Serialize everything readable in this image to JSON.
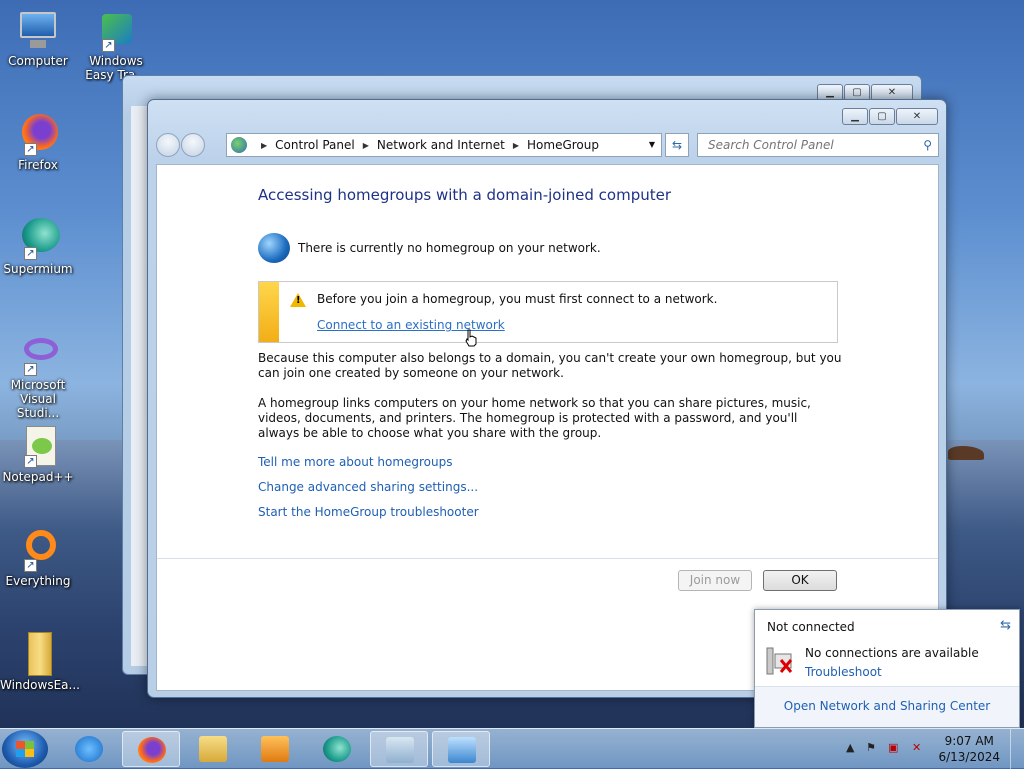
{
  "desktop": {
    "icons": [
      {
        "label": "Computer",
        "icon": "computer-icon"
      },
      {
        "label": "Windows Easy Tra...",
        "icon": "easy-transfer-icon"
      },
      {
        "label": "Firefox",
        "icon": "firefox-icon"
      },
      {
        "label": "Supermium",
        "icon": "supermium-icon"
      },
      {
        "label": "Microsoft Visual Studi...",
        "icon": "visual-studio-icon"
      },
      {
        "label": "Notepad++",
        "icon": "notepadpp-icon"
      },
      {
        "label": "Everything",
        "icon": "everything-icon"
      },
      {
        "label": "WindowsEa...",
        "icon": "folder-icon"
      }
    ]
  },
  "window": {
    "breadcrumb": [
      "Control Panel",
      "Network and Internet",
      "HomeGroup"
    ],
    "search_placeholder": "Search Control Panel",
    "heading": "Accessing homegroups with a domain-joined computer",
    "status": "There is currently no homegroup on your network.",
    "warning": {
      "text": "Before you join a homegroup, you must first connect to a network.",
      "link": "Connect to an existing network"
    },
    "para1": "Because this computer also belongs to a domain, you can't create your own homegroup, but you can join one created by someone on your network.",
    "para2": "A homegroup links computers on your home network so that you can share pictures, music, videos, documents, and printers. The homegroup is protected with a password, and you'll always be able to choose what you share with the group.",
    "links": [
      "Tell me more about homegroups",
      "Change advanced sharing settings...",
      "Start the HomeGroup troubleshooter"
    ],
    "buttons": {
      "join": "Join now",
      "ok": "OK"
    }
  },
  "flyout": {
    "title": "Not connected",
    "message": "No connections are available",
    "troubleshoot": "Troubleshoot",
    "open_center": "Open Network and Sharing Center"
  },
  "taskbar": {
    "time": "9:07 AM",
    "date": "6/13/2024",
    "apps": [
      "internet-explorer-icon",
      "firefox-icon",
      "explorer-icon",
      "media-player-icon",
      "supermium-icon",
      "device-icon",
      "control-panel-icon"
    ]
  },
  "colors": {
    "heading": "#1e3287",
    "link": "#1f5fb4",
    "warning_bar": "#f2ae16"
  }
}
